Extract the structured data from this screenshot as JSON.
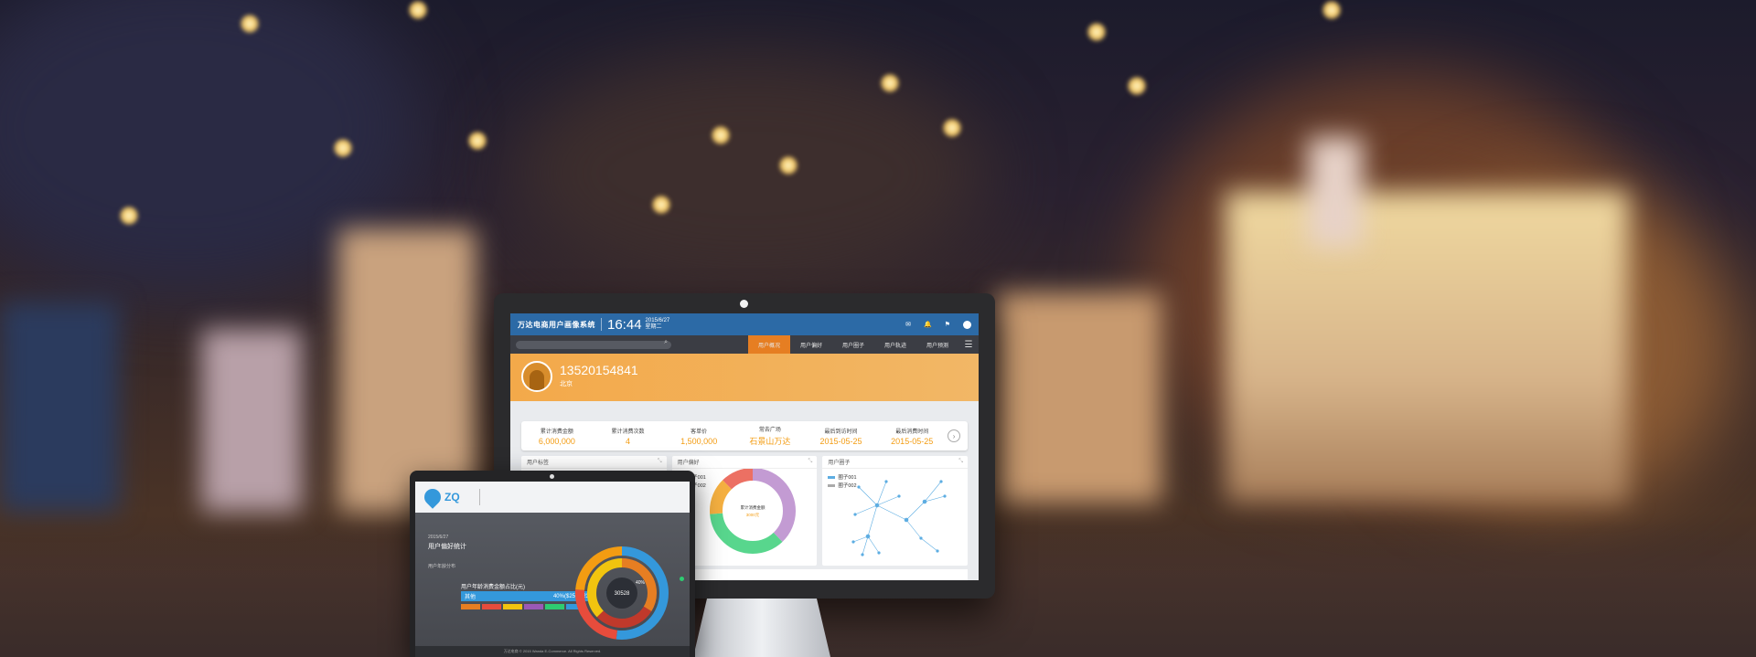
{
  "desktop": {
    "brand": "万达电商用户画像系统",
    "clock": "16:44",
    "date": "2015/6/27",
    "weekday": "星期二",
    "nav_tabs": [
      {
        "label": "用户概况",
        "active": true
      },
      {
        "label": "用户偏好",
        "active": false
      },
      {
        "label": "用户圈子",
        "active": false
      },
      {
        "label": "用户轨迹",
        "active": false
      },
      {
        "label": "用户预测",
        "active": false
      }
    ],
    "user": {
      "phone": "13520154841",
      "city": "北京"
    },
    "stats": [
      {
        "label": "累计消费金额",
        "value": "6,000,000"
      },
      {
        "label": "累计消费次数",
        "value": "4"
      },
      {
        "label": "客单价",
        "value": "1,500,000"
      },
      {
        "label": "常去广场",
        "value": "石景山万达"
      },
      {
        "label": "最后到访时间",
        "value": "2015-05-25"
      },
      {
        "label": "最后消费时间",
        "value": "2015-05-25"
      }
    ],
    "cards": [
      {
        "title": "用户标签"
      },
      {
        "title": "用户偏好",
        "legend": [
          "圈子001",
          "圈子002"
        ],
        "center_label": "累计消费金额",
        "center_value": "3000元"
      },
      {
        "title": "用户圈子",
        "legend": [
          "圈子001",
          "圈子002"
        ]
      }
    ],
    "accent": "#2c6aa6",
    "highlight": "#e67e22"
  },
  "laptop": {
    "logo": "ZQ",
    "crumb": "2015/6/27",
    "title": "用户偏好统计",
    "sub": "用户年龄分布",
    "subtitle": "用户年龄消费金额占比(元)",
    "bar_label": "其他",
    "bar_value": "40%($2573.23)",
    "center_value": "30528",
    "ring_label": "40%",
    "footer": "万达电商 © 2015 Wanda E-Commerce. All Rights Reserved."
  }
}
